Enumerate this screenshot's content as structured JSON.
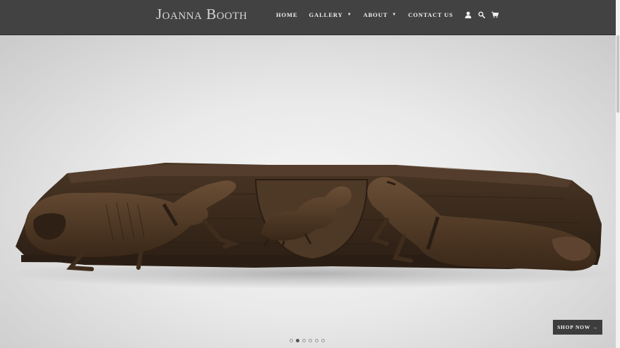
{
  "brand": {
    "logo_text": "Joanna Booth"
  },
  "nav": {
    "home": "HOME",
    "gallery": "GALLERY",
    "about": "ABOUT",
    "contact": "CONTACT US",
    "dropdown_glyph": "▼",
    "icons": [
      "account-icon",
      "search-icon",
      "cart-icon"
    ]
  },
  "hero": {
    "image_subject": "carved-oak-panel-with-beasts",
    "button_label": "SHOP NOW →",
    "slides_total": 6,
    "active_slide": 2
  },
  "colors": {
    "header_bg": "#424242",
    "nav_text": "#f2f2f2",
    "logo_text": "#d6d6d6",
    "button_bg": "#3d3d3d",
    "wood_dark": "#3a2a1c",
    "wood_mid": "#5a4230"
  }
}
